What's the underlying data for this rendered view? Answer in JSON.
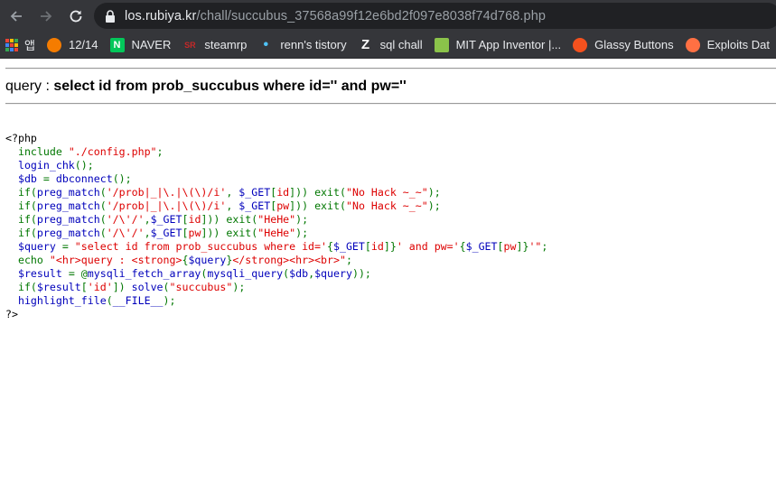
{
  "browser": {
    "url_host": "los.rubiya.kr",
    "url_path": "/chall/succubus_37568a99f12e6bd2f097e8038f74d768.php",
    "bookmarks": [
      {
        "label": "앱",
        "color": "#e8eaed",
        "icon": "apps-icon"
      },
      {
        "label": "12/14",
        "color": "#f57c00",
        "icon": "blogger-icon"
      },
      {
        "label": "NAVER",
        "color": "#03c75a",
        "icon": "naver-icon"
      },
      {
        "label": "steamrp",
        "color": "#c62828",
        "icon": "steamrp-icon"
      },
      {
        "label": "renn's tistory",
        "color": "#4fc3f7",
        "icon": "tistory-icon"
      },
      {
        "label": "sql chall",
        "color": "#ffffff",
        "icon": "z-icon"
      },
      {
        "label": "MIT App Inventor |...",
        "color": "#8bc34a",
        "icon": "app-inventor-icon"
      },
      {
        "label": "Glassy Buttons",
        "color": "#f4511e",
        "icon": "glassy-icon"
      },
      {
        "label": "Exploits Dat",
        "color": "#ff7043",
        "icon": "exploits-icon"
      }
    ]
  },
  "page": {
    "query_label": "query : ",
    "query_value": "select id from prob_succubus where id='' and pw=''",
    "code_lines": [
      [
        {
          "t": "<?php",
          "c": "tag"
        }
      ],
      [
        {
          "t": "  include ",
          "c": "def"
        },
        {
          "t": "\"./config.php\"",
          "c": "str"
        },
        {
          "t": ";",
          "c": "def"
        }
      ],
      [
        {
          "t": "  login_chk",
          "c": "var"
        },
        {
          "t": "();",
          "c": "def"
        }
      ],
      [
        {
          "t": "  $db ",
          "c": "var"
        },
        {
          "t": "= ",
          "c": "def"
        },
        {
          "t": "dbconnect",
          "c": "var"
        },
        {
          "t": "();",
          "c": "def"
        }
      ],
      [
        {
          "t": "  if(",
          "c": "def"
        },
        {
          "t": "preg_match",
          "c": "var"
        },
        {
          "t": "(",
          "c": "def"
        },
        {
          "t": "'/prob|_|\\.|\\(\\)/i'",
          "c": "str"
        },
        {
          "t": ", ",
          "c": "def"
        },
        {
          "t": "$_GET",
          "c": "var"
        },
        {
          "t": "[",
          "c": "def"
        },
        {
          "t": "id",
          "c": "str"
        },
        {
          "t": "])) exit(",
          "c": "def"
        },
        {
          "t": "\"No Hack ~_~\"",
          "c": "str"
        },
        {
          "t": ");",
          "c": "def"
        }
      ],
      [
        {
          "t": "  if(",
          "c": "def"
        },
        {
          "t": "preg_match",
          "c": "var"
        },
        {
          "t": "(",
          "c": "def"
        },
        {
          "t": "'/prob|_|\\.|\\(\\)/i'",
          "c": "str"
        },
        {
          "t": ", ",
          "c": "def"
        },
        {
          "t": "$_GET",
          "c": "var"
        },
        {
          "t": "[",
          "c": "def"
        },
        {
          "t": "pw",
          "c": "str"
        },
        {
          "t": "])) exit(",
          "c": "def"
        },
        {
          "t": "\"No Hack ~_~\"",
          "c": "str"
        },
        {
          "t": ");",
          "c": "def"
        }
      ],
      [
        {
          "t": "  if(",
          "c": "def"
        },
        {
          "t": "preg_match",
          "c": "var"
        },
        {
          "t": "(",
          "c": "def"
        },
        {
          "t": "'/\\'/'",
          "c": "str"
        },
        {
          "t": ",",
          "c": "def"
        },
        {
          "t": "$_GET",
          "c": "var"
        },
        {
          "t": "[",
          "c": "def"
        },
        {
          "t": "id",
          "c": "str"
        },
        {
          "t": "])) exit(",
          "c": "def"
        },
        {
          "t": "\"HeHe\"",
          "c": "str"
        },
        {
          "t": ");",
          "c": "def"
        }
      ],
      [
        {
          "t": "  if(",
          "c": "def"
        },
        {
          "t": "preg_match",
          "c": "var"
        },
        {
          "t": "(",
          "c": "def"
        },
        {
          "t": "'/\\'/'",
          "c": "str"
        },
        {
          "t": ",",
          "c": "def"
        },
        {
          "t": "$_GET",
          "c": "var"
        },
        {
          "t": "[",
          "c": "def"
        },
        {
          "t": "pw",
          "c": "str"
        },
        {
          "t": "])) exit(",
          "c": "def"
        },
        {
          "t": "\"HeHe\"",
          "c": "str"
        },
        {
          "t": ");",
          "c": "def"
        }
      ],
      [
        {
          "t": "  $query ",
          "c": "var"
        },
        {
          "t": "= ",
          "c": "def"
        },
        {
          "t": "\"select id from prob_succubus where id='",
          "c": "str"
        },
        {
          "t": "{",
          "c": "def"
        },
        {
          "t": "$_GET",
          "c": "var"
        },
        {
          "t": "[",
          "c": "def"
        },
        {
          "t": "id",
          "c": "str"
        },
        {
          "t": "]}",
          "c": "def"
        },
        {
          "t": "' and pw='",
          "c": "str"
        },
        {
          "t": "{",
          "c": "def"
        },
        {
          "t": "$_GET",
          "c": "var"
        },
        {
          "t": "[",
          "c": "def"
        },
        {
          "t": "pw",
          "c": "str"
        },
        {
          "t": "]}",
          "c": "def"
        },
        {
          "t": "'\"",
          "c": "str"
        },
        {
          "t": ";",
          "c": "def"
        }
      ],
      [
        {
          "t": "  echo ",
          "c": "def"
        },
        {
          "t": "\"<hr>query : <strong>",
          "c": "str"
        },
        {
          "t": "{",
          "c": "def"
        },
        {
          "t": "$query",
          "c": "var"
        },
        {
          "t": "}",
          "c": "def"
        },
        {
          "t": "</strong><hr><br>\"",
          "c": "str"
        },
        {
          "t": ";",
          "c": "def"
        }
      ],
      [
        {
          "t": "  $result ",
          "c": "var"
        },
        {
          "t": "= @",
          "c": "def"
        },
        {
          "t": "mysqli_fetch_array",
          "c": "var"
        },
        {
          "t": "(",
          "c": "def"
        },
        {
          "t": "mysqli_query",
          "c": "var"
        },
        {
          "t": "(",
          "c": "def"
        },
        {
          "t": "$db",
          "c": "var"
        },
        {
          "t": ",",
          "c": "def"
        },
        {
          "t": "$query",
          "c": "var"
        },
        {
          "t": "));",
          "c": "def"
        }
      ],
      [
        {
          "t": "  if(",
          "c": "def"
        },
        {
          "t": "$result",
          "c": "var"
        },
        {
          "t": "[",
          "c": "def"
        },
        {
          "t": "'id'",
          "c": "str"
        },
        {
          "t": "]) ",
          "c": "def"
        },
        {
          "t": "solve",
          "c": "var"
        },
        {
          "t": "(",
          "c": "def"
        },
        {
          "t": "\"succubus\"",
          "c": "str"
        },
        {
          "t": ");",
          "c": "def"
        }
      ],
      [
        {
          "t": "  highlight_file",
          "c": "var"
        },
        {
          "t": "(",
          "c": "def"
        },
        {
          "t": "__FILE__",
          "c": "var"
        },
        {
          "t": ");",
          "c": "def"
        }
      ],
      [
        {
          "t": "?>",
          "c": "tag"
        }
      ]
    ]
  }
}
